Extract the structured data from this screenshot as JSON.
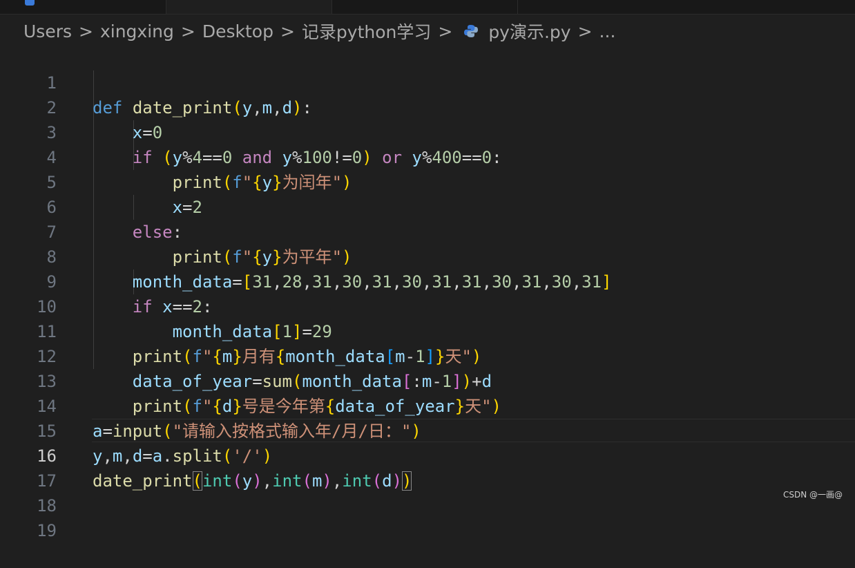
{
  "breadcrumb": {
    "items": [
      "Users",
      "xingxing",
      "Desktop",
      "记录python学习"
    ],
    "file": "py演示.py",
    "ellipsis": "...",
    "separator": ">"
  },
  "line_numbers": [
    "1",
    "2",
    "3",
    "4",
    "5",
    "6",
    "7",
    "8",
    "9",
    "10",
    "11",
    "12",
    "13",
    "14",
    "15",
    "16",
    "17",
    "18",
    "19"
  ],
  "active_line": "16",
  "code_lines": [
    "def date_print(y,m,d):",
    "    x=0",
    "    if (y%4==0 and y%100!=0) or y%400==0:",
    "        print(f\"{y}为闰年\")",
    "        x=2",
    "    else:",
    "        print(f\"{y}为平年\")",
    "    month_data=[31,28,31,30,31,30,31,31,30,31,30,31]",
    "    if x==2:",
    "        month_data[1]=29",
    "    print(f\"{m}月有{month_data[m-1]}天\")",
    "    data_of_year=sum(month_data[:m-1])+d",
    "    print(f\"{d}号是今年第{data_of_year}天\")",
    "a=input(\"请输入按格式输入年/月/日：\")",
    "y,m,d=a.split('/')",
    "date_print(int(y),int(m),int(d))"
  ],
  "watermark": "CSDN @一画@",
  "colors": {
    "background": "#1f1f1f",
    "keyword": "#569cd6",
    "control": "#c586c0",
    "function": "#dcdcaa",
    "variable": "#9cdcfe",
    "number": "#b5cea8",
    "string": "#ce9178",
    "bracket_gold": "#ffd700",
    "bracket_orchid": "#da70d6",
    "bracket_blue": "#179fff",
    "builtin": "#4ec9b0"
  }
}
